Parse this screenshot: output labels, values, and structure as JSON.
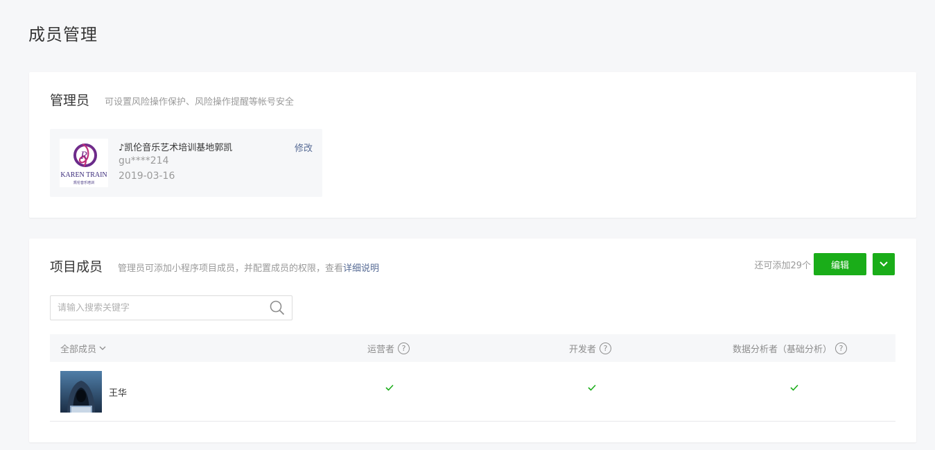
{
  "page": {
    "title": "成员管理"
  },
  "admin": {
    "title": "管理员",
    "desc": "可设置风险操作保护、风险操作提醒等帐号安全",
    "name": "♪凯伦音乐艺术培训基地郭凯",
    "id": "gu****214",
    "date": "2019-03-16",
    "edit_label": "修改",
    "logo_text": "KAREN TRAIN",
    "logo_sub": "凯伦音乐培训"
  },
  "members": {
    "title": "项目成员",
    "desc": "管理员可添加小程序项目成员，并配置成员的权限，查看",
    "desc_link": "详细说明",
    "remaining": "还可添加29个",
    "edit_button": "编辑",
    "search_placeholder": "请输入搜索关键字",
    "columns": [
      "全部成员",
      "运营者",
      "开发者",
      "数据分析者（基础分析）"
    ],
    "rows": [
      {
        "name": "王华",
        "operator": true,
        "developer": true,
        "analyst": true
      }
    ]
  },
  "colors": {
    "accent": "#1aad19",
    "link": "#576b95"
  }
}
